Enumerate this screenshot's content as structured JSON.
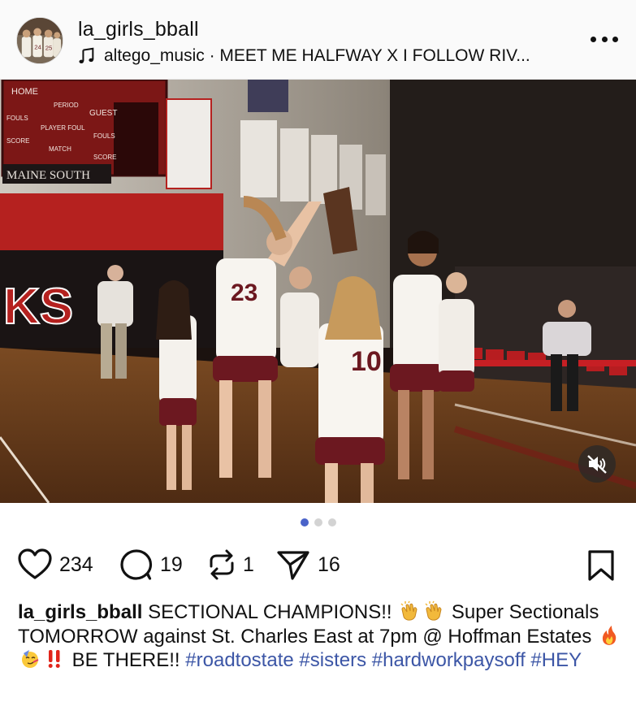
{
  "header": {
    "username": "la_girls_bball",
    "music_label": "altego_music · MEET ME HALFWAY X I FOLLOW RIV..."
  },
  "icons": {
    "music": "music-note-icon",
    "more": "more-horizontal-icon",
    "mute": "speaker-muted-icon",
    "like": "heart-icon",
    "comment": "comment-bubble-icon",
    "repost": "repost-arrows-icon",
    "share": "paper-plane-icon",
    "save": "bookmark-icon"
  },
  "media": {
    "scoreboard_labels": [
      "HOME",
      "PERIOD",
      "GUEST",
      "FOULS",
      "PLAYER FOUL",
      "FOULS",
      "SCORE",
      "MATCH",
      "SCORE"
    ],
    "gym_sign": "MAINE SOUTH",
    "wall_letters": "KS",
    "jersey_numbers": [
      "23",
      "10"
    ],
    "carousel_total": 3,
    "carousel_active": 1
  },
  "stats": {
    "likes": "234",
    "comments": "19",
    "reposts": "1",
    "shares": "16"
  },
  "caption": {
    "username": "la_girls_bball",
    "part1": "SECTIONAL CHAMPIONS!!",
    "part2": "Super Sectionals TOMORROW against St. Charles East at 7pm @ Hoffman Estates",
    "part3": "BE THERE!!",
    "hashtags": [
      "#roadtostate",
      "#sisters",
      "#hardworkpaysoff",
      "#HEY"
    ]
  },
  "colors": {
    "hashtag": "#3c56a6",
    "pager_active": "#4a63c9",
    "pager_inactive": "#d3d3d3"
  }
}
